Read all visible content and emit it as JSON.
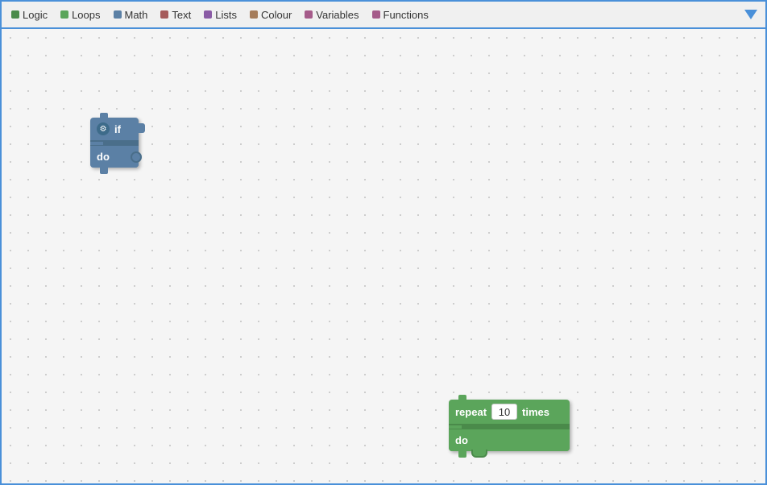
{
  "toolbar": {
    "items": [
      {
        "label": "Logic",
        "color": "#4a8a4a",
        "id": "logic"
      },
      {
        "label": "Loops",
        "color": "#5ba55b",
        "id": "loops"
      },
      {
        "label": "Math",
        "color": "#5b80a5",
        "id": "math"
      },
      {
        "label": "Text",
        "color": "#a55b5b",
        "id": "text"
      },
      {
        "label": "Lists",
        "color": "#8a5ba5",
        "id": "lists"
      },
      {
        "label": "Colour",
        "color": "#a57c5b",
        "id": "colour"
      },
      {
        "label": "Variables",
        "color": "#a55b8a",
        "id": "variables"
      },
      {
        "label": "Functions",
        "color": "#a55b8a",
        "id": "functions"
      }
    ],
    "arrow_icon": "▼"
  },
  "blocks": {
    "if_block": {
      "label_top": "if",
      "label_bottom": "do",
      "gear_icon": "⚙"
    },
    "repeat_block": {
      "label_repeat": "repeat",
      "value": "10",
      "label_times": "times",
      "label_do": "do"
    }
  },
  "colors": {
    "toolbar_bg": "#f0f0f0",
    "border": "#4a90d9",
    "workspace_bg": "#f5f5f5",
    "block_if": "#5b80a5",
    "block_repeat": "#5ba55b",
    "arrow": "#4a90d9"
  }
}
